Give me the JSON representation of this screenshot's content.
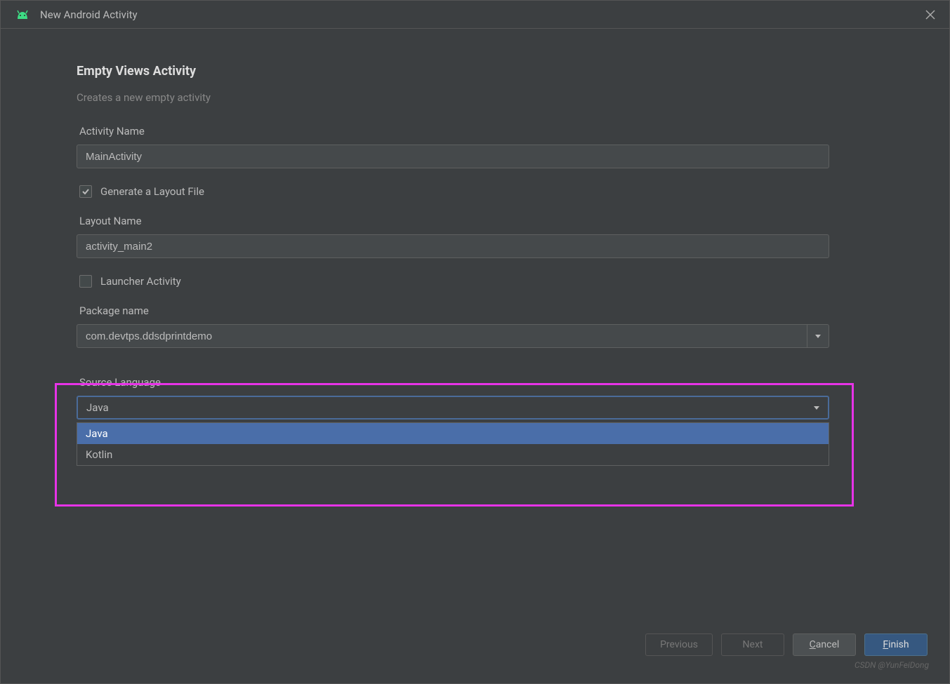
{
  "titlebar": {
    "title": "New Android Activity"
  },
  "header": {
    "section_title": "Empty Views Activity",
    "subtitle": "Creates a new empty activity"
  },
  "fields": {
    "activity_name": {
      "label": "Activity Name",
      "value": "MainActivity"
    },
    "generate_layout": {
      "label": "Generate a Layout File",
      "checked": true
    },
    "layout_name": {
      "label": "Layout Name",
      "value": "activity_main2"
    },
    "launcher_activity": {
      "label": "Launcher Activity",
      "checked": false
    },
    "package_name": {
      "label": "Package name",
      "value": "com.devtps.ddsdprintdemo"
    },
    "source_language": {
      "label": "Source Language",
      "value": "Java",
      "options": [
        "Java",
        "Kotlin"
      ],
      "selected_index": 0
    }
  },
  "buttons": {
    "previous": "Previous",
    "next": "Next",
    "cancel_pre": "C",
    "cancel_post": "ancel",
    "finish_pre": "F",
    "finish_post": "inish"
  },
  "watermark": "CSDN @YunFeiDong"
}
